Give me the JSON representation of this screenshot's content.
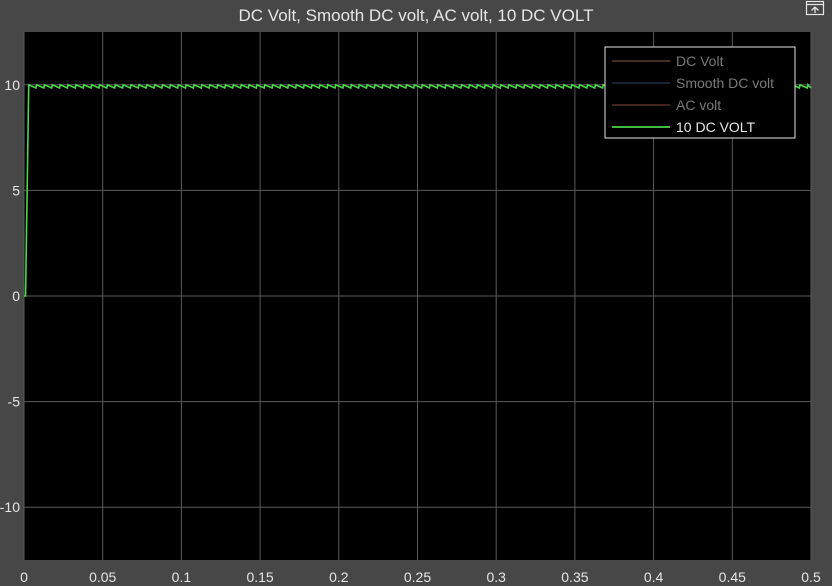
{
  "window": {
    "undock_icon": "undock-icon"
  },
  "colors": {
    "background": "#474747",
    "plot_area": "#000000",
    "grid": "#5a5a5a",
    "text": "#e6e6e6",
    "dim_text": "#7a7a7a"
  },
  "chart_data": {
    "type": "line",
    "title": "DC Volt, Smooth DC volt, AC volt, 10 DC VOLT",
    "xlabel": "",
    "ylabel": "",
    "xlim": [
      0,
      0.5
    ],
    "ylim": [
      -12.5,
      12.5
    ],
    "xticks": [
      0,
      0.05,
      0.1,
      0.15,
      0.2,
      0.25,
      0.3,
      0.35,
      0.4,
      0.45,
      0.5
    ],
    "xtick_labels": [
      "0",
      "0.05",
      "0.1",
      "0.15",
      "0.2",
      "0.25",
      "0.3",
      "0.35",
      "0.4",
      "0.45",
      "0.5"
    ],
    "yticks": [
      -10,
      -5,
      0,
      5,
      10
    ],
    "ytick_labels": [
      "-10",
      "-5",
      "0",
      "5",
      "10"
    ],
    "grid": true,
    "legend_position": "top-right",
    "series": [
      {
        "name": "DC Volt",
        "color": "#6b4a3a",
        "visible": false
      },
      {
        "name": "Smooth DC volt",
        "color": "#2a3550",
        "visible": false
      },
      {
        "name": "AC volt",
        "color": "#6a3a2a",
        "visible": false
      },
      {
        "name": "10 DC VOLT",
        "color": "#4cd64c",
        "visible": true,
        "description": "rises from 0 to 10 at t≈0.003, then holds at ~10 with small sawtooth ripple (peak ~10, trough ~9.85) every ~0.005 s",
        "x": [
          0,
          0.001,
          0.003,
          0.5
        ],
        "y": [
          0,
          0,
          10,
          10
        ],
        "ripple": {
          "period": 0.005,
          "peak": 10.0,
          "trough": 9.85,
          "start": 0.003
        }
      }
    ]
  }
}
